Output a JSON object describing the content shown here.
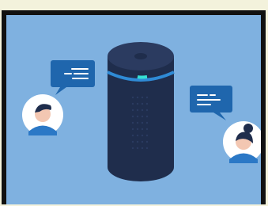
{
  "scene": {
    "colors": {
      "background": "#7fb1e0",
      "frame": "#111111",
      "outer": "#f3f2dc",
      "speaker_body": "#1f2d4c",
      "speaker_top": "#2b3b60",
      "speaker_ring": "#2f8bd6",
      "speaker_ring_highlight": "#35e0d3",
      "bubble": "#1f66ad",
      "bubble_lines": "#ffffff",
      "avatar_circle": "#ffffff",
      "skin": "#f3c7b2",
      "hair": "#1f2d4c",
      "shirt": "#2b78c6"
    },
    "elements": {
      "speaker": "smart-speaker",
      "left_bubble": "chat-bubble",
      "right_bubble": "chat-bubble",
      "left_avatar": "male-user",
      "right_avatar": "female-user"
    }
  }
}
